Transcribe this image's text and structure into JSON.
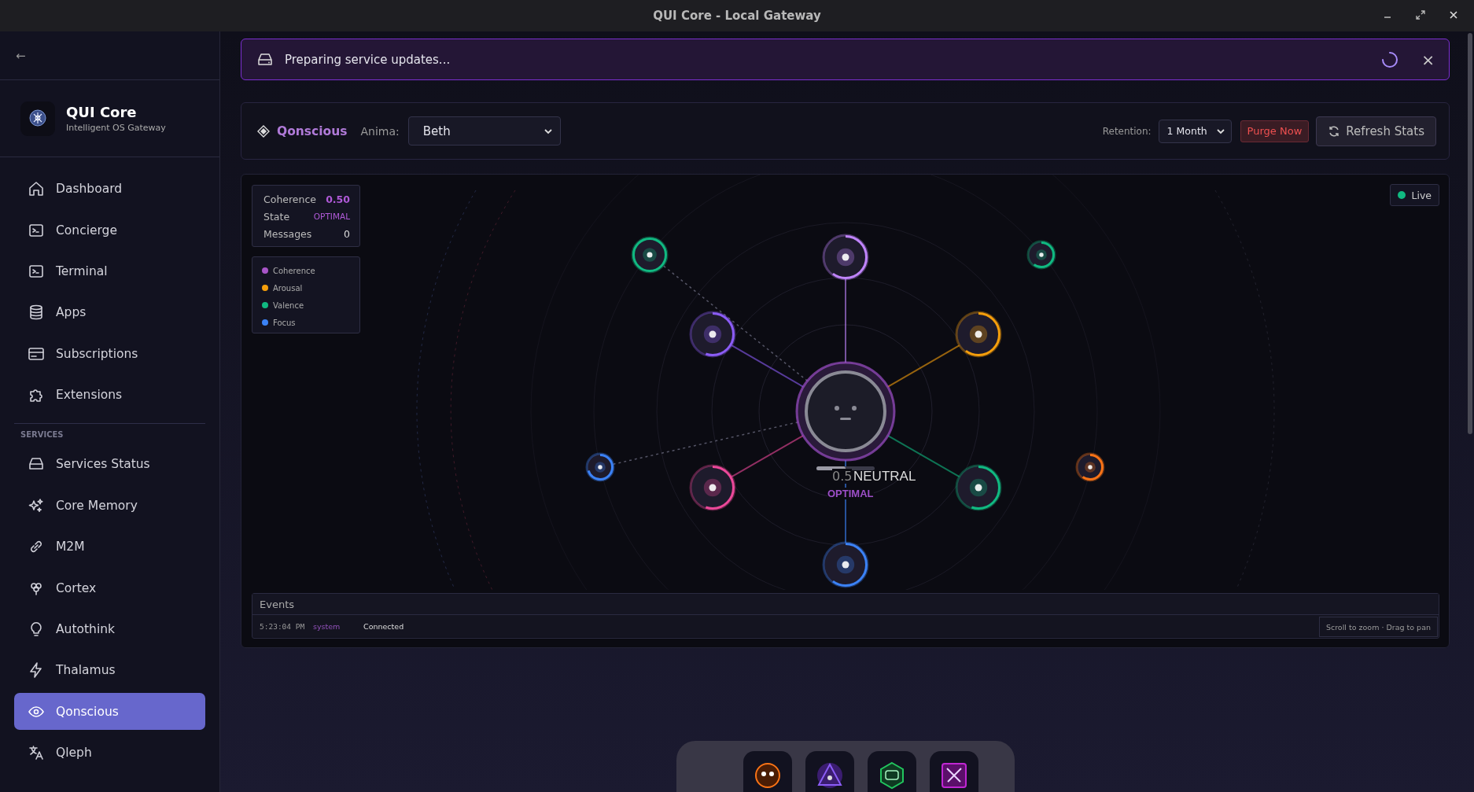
{
  "window": {
    "title": "QUI Core - Local Gateway"
  },
  "sidebar": {
    "back": "←",
    "brand": {
      "name": "QUI Core",
      "subtitle": "Intelligent OS Gateway"
    },
    "items": [
      {
        "label": "Dashboard",
        "selected": false
      },
      {
        "label": "Concierge",
        "selected": false
      },
      {
        "label": "Terminal",
        "selected": false
      },
      {
        "label": "Apps",
        "selected": false
      },
      {
        "label": "Subscriptions",
        "selected": false
      },
      {
        "label": "Extensions",
        "selected": false
      }
    ],
    "section": "SERVICES",
    "service_items": [
      {
        "label": "Services Status",
        "selected": false
      },
      {
        "label": "Core Memory",
        "selected": false
      },
      {
        "label": "M2M",
        "selected": false
      },
      {
        "label": "Cortex",
        "selected": false
      },
      {
        "label": "Autothink",
        "selected": false
      },
      {
        "label": "Thalamus",
        "selected": false
      },
      {
        "label": "Qonscious",
        "selected": true
      },
      {
        "label": "Qleph",
        "selected": false
      }
    ]
  },
  "banner": {
    "message": "Preparing service updates...",
    "close": "×"
  },
  "header": {
    "title": "Qonscious",
    "anima_label": "Anima:",
    "anima": "Beth",
    "retention_label": "Retention:",
    "retention": "1 Month",
    "purge": "Purge Now",
    "refresh": "Refresh Stats"
  },
  "stats": [
    {
      "label": "Coherence",
      "value": "0.50",
      "kind": "score"
    },
    {
      "label": "State",
      "value": "OPTIMAL",
      "kind": "state"
    },
    {
      "label": "Messages",
      "value": "0",
      "kind": "count"
    }
  ],
  "legend": [
    {
      "label": "Coherence",
      "color": "#a855c8"
    },
    {
      "label": "Arousal",
      "color": "#f59e0b"
    },
    {
      "label": "Valence",
      "color": "#10b981"
    },
    {
      "label": "Focus",
      "color": "#3b82f6"
    }
  ],
  "live": {
    "label": "Live",
    "on": true
  },
  "center": {
    "value": "0.5",
    "mood": "NEUTRAL",
    "state": "OPTIMAL",
    "level": 0.5
  },
  "events": {
    "title": "Events",
    "rows": [
      {
        "time": "5:23:04 PM",
        "source": "system",
        "message": "Connected"
      }
    ],
    "hint": "Scroll to zoom · Drag to pan"
  }
}
